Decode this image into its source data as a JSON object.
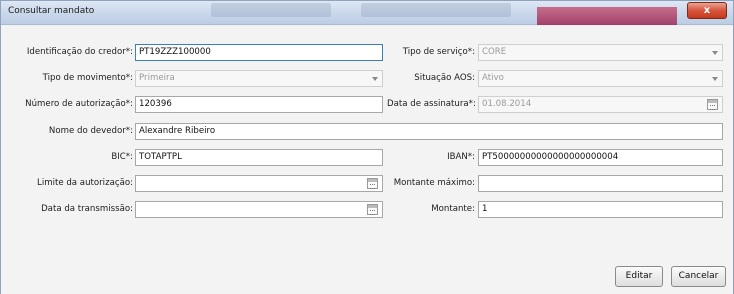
{
  "window": {
    "title": "Consultar mandato",
    "close_label": "x"
  },
  "form": {
    "identificacao_credor": {
      "label": "Identificação do credor*:",
      "value": "PT19ZZZ100000"
    },
    "tipo_servico": {
      "label": "Tipo de serviço*:",
      "value": "CORE"
    },
    "tipo_movimento": {
      "label": "Tipo de movimento*:",
      "value": "Primeira"
    },
    "situacao_aos": {
      "label": "Situação AOS:",
      "value": "Ativo"
    },
    "numero_autorizacao": {
      "label": "Número de autorização*:",
      "value": "120396"
    },
    "data_assinatura": {
      "label": "Data de assinatura*:",
      "value": "01.08.2014"
    },
    "nome_devedor": {
      "label": "Nome do devedor*:",
      "value": "Alexandre Ribeiro"
    },
    "bic": {
      "label": "BIC*:",
      "value": "TOTAPTPL"
    },
    "iban": {
      "label": "IBAN*:",
      "value": "PT50000000000000000000004"
    },
    "limite_autorizacao": {
      "label": "Limite da autorização:",
      "value": ""
    },
    "montante_maximo": {
      "label": "Montante máximo:",
      "value": ""
    },
    "data_transmissao": {
      "label": "Data da transmissão:",
      "value": ""
    },
    "montante": {
      "label": "Montante:",
      "value": "1"
    }
  },
  "buttons": {
    "editar": "Editar",
    "cancelar": "Cancelar"
  }
}
